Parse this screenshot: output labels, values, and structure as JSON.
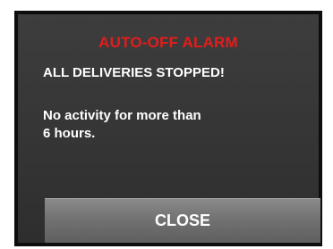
{
  "dialog": {
    "title": "AUTO-OFF ALARM",
    "headline": "ALL DELIVERIES STOPPED!",
    "message_line1": "No activity for more than",
    "message_line2": "6 hours.",
    "close_label": "CLOSE"
  },
  "colors": {
    "title": "#e51c1c",
    "text": "#ffffff",
    "dialog_background": "#363636",
    "button_background": "#747474"
  }
}
